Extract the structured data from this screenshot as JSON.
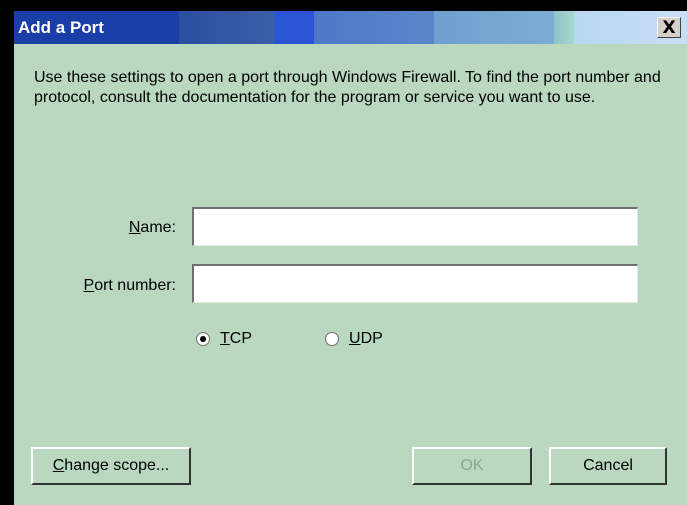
{
  "window": {
    "title": "Add a Port",
    "close_symbol": "X"
  },
  "description": "Use these settings to open a port through Windows Firewall. To find the port number and protocol, consult the documentation for the program or service you want to use.",
  "form": {
    "name": {
      "label_key": "N",
      "label_rest": "ame:",
      "value": ""
    },
    "port": {
      "label_key": "P",
      "label_rest": "ort number:",
      "value": ""
    }
  },
  "protocol": {
    "tcp": {
      "key": "T",
      "rest": "CP",
      "selected": true
    },
    "udp": {
      "key": "U",
      "rest": "DP",
      "selected": false
    }
  },
  "buttons": {
    "change_scope_key": "C",
    "change_scope_rest": "hange scope...",
    "ok": "OK",
    "cancel": "Cancel"
  },
  "colors": {
    "dialog_bg": "#b9d8bf",
    "title_text": "#ffffff"
  }
}
